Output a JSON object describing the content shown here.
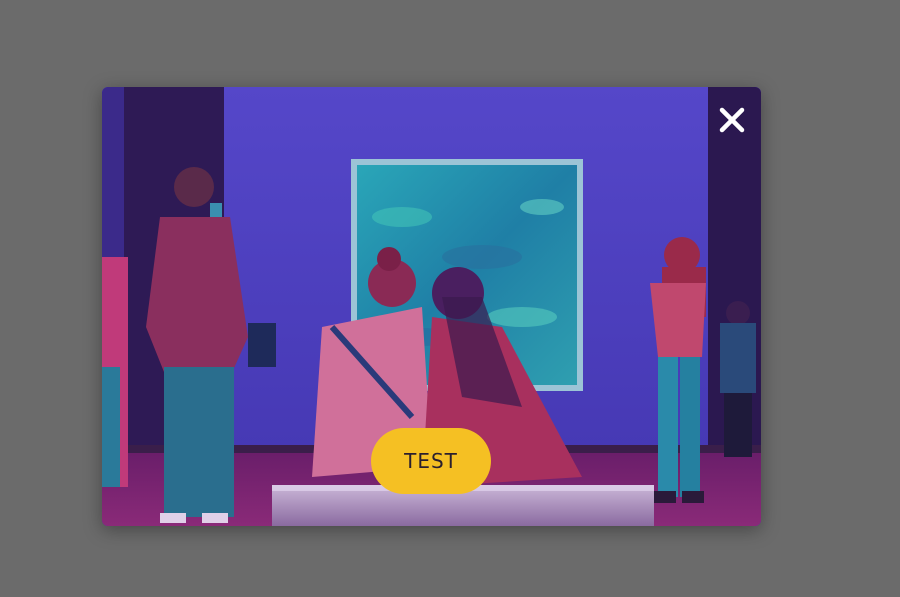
{
  "modal": {
    "close_icon": "close-icon",
    "image_description_icon": "gallery-photo",
    "cta_label": "TEST"
  },
  "colors": {
    "backdrop": "#6b6b6b",
    "wall": "#4a3fc0",
    "floor": "#7a1f6e",
    "button": "#f5c023",
    "button_text": "#2a1f2e",
    "close": "#ffffff"
  }
}
